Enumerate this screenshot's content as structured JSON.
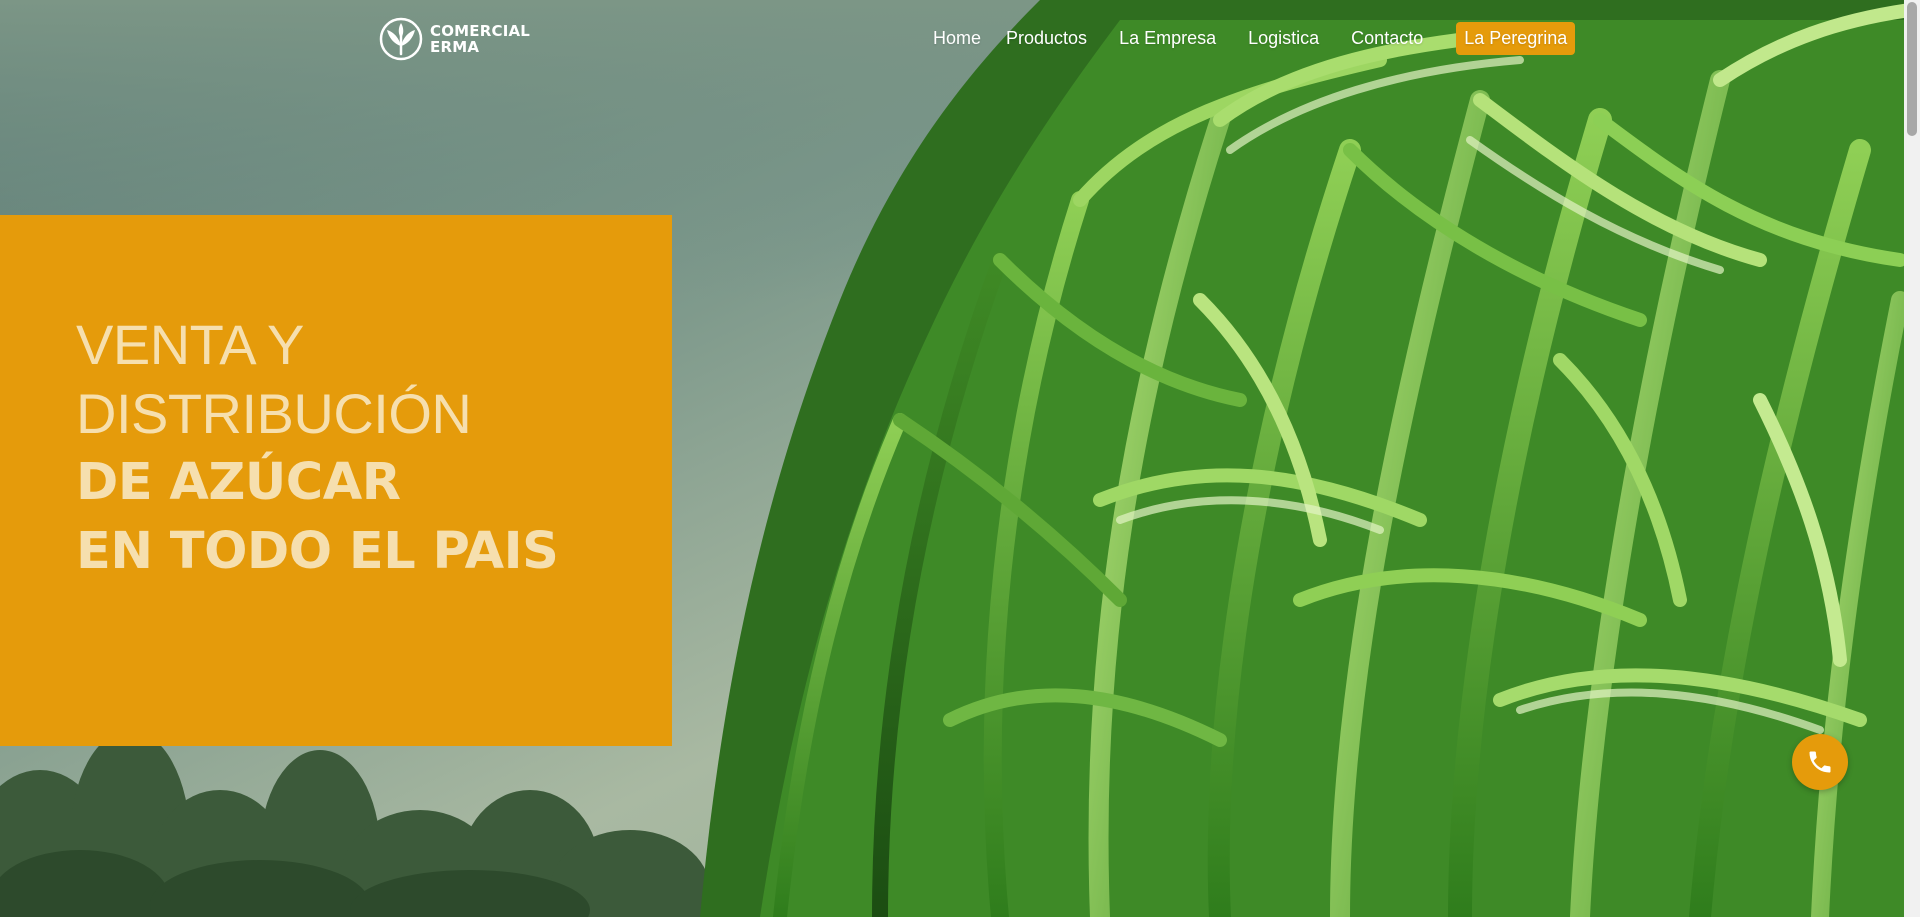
{
  "header": {
    "logo": {
      "line1": "COMERCIAL",
      "line2": "ERMA"
    },
    "nav": [
      {
        "label": "Home"
      },
      {
        "label": "Productos"
      },
      {
        "label": "La Empresa"
      },
      {
        "label": "Logistica"
      },
      {
        "label": "Contacto"
      },
      {
        "label": "La Peregrina"
      }
    ]
  },
  "hero": {
    "line1": "VENTA Y",
    "line2": "DISTRIBUCIÓN",
    "line3": "DE AZÚCAR",
    "line4": "EN TODO EL PAIS",
    "image": "sugarcane-field"
  },
  "fab": {
    "icon": "phone-icon"
  },
  "colors": {
    "accent": "#e59b0b",
    "hero_text": "#f6dfae",
    "nav_text": "#ffffff"
  }
}
